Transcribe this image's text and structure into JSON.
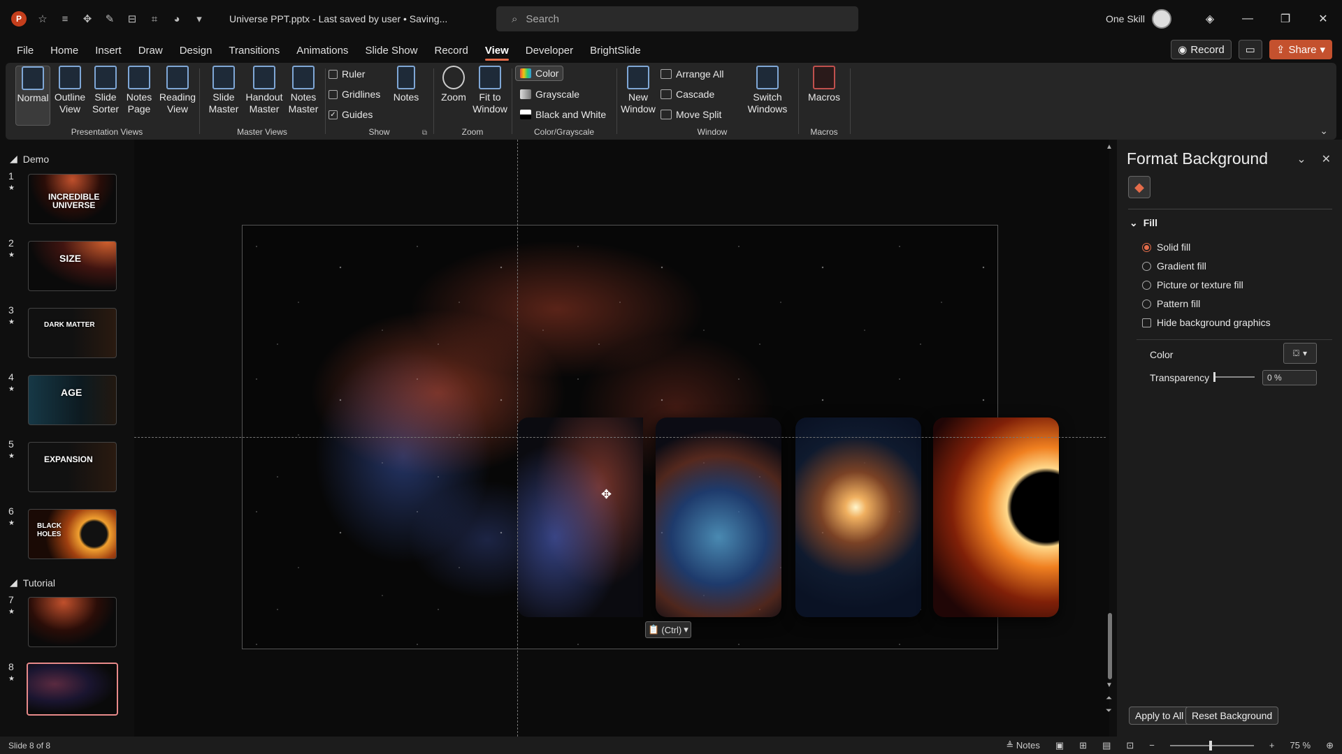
{
  "app": {
    "logo": "P",
    "doc_title": "Universe PPT.pptx  -  Last saved by user  •  Saving...",
    "user": "One Skill"
  },
  "search": {
    "placeholder": "Search"
  },
  "menu": {
    "tabs": [
      "File",
      "Home",
      "Insert",
      "Draw",
      "Design",
      "Transitions",
      "Animations",
      "Slide Show",
      "Record",
      "View",
      "Developer",
      "BrightSlide"
    ],
    "active": "View"
  },
  "menu_right": {
    "record": "Record",
    "share": "Share"
  },
  "ribbon": {
    "presentation_views": {
      "label": "Presentation Views",
      "buttons": [
        "Normal",
        "Outline\nView",
        "Slide\nSorter",
        "Notes\nPage",
        "Reading\nView"
      ]
    },
    "master_views": {
      "label": "Master Views",
      "buttons": [
        "Slide\nMaster",
        "Handout\nMaster",
        "Notes\nMaster"
      ]
    },
    "show": {
      "label": "Show",
      "ruler": "Ruler",
      "gridlines": "Gridlines",
      "guides": "Guides",
      "notes": "Notes"
    },
    "zoom": {
      "label": "Zoom",
      "zoom": "Zoom",
      "fit": "Fit to\nWindow"
    },
    "color": {
      "label": "Color/Grayscale",
      "color": "Color",
      "grayscale": "Grayscale",
      "bw": "Black and White"
    },
    "window": {
      "label": "Window",
      "new": "New\nWindow",
      "arrange": "Arrange All",
      "cascade": "Cascade",
      "move_split": "Move Split",
      "switch": "Switch\nWindows"
    },
    "macros": {
      "label": "Macros",
      "macros": "Macros"
    }
  },
  "slides": {
    "sections": [
      "Demo",
      "Tutorial"
    ],
    "items": [
      {
        "num": "1",
        "text": "INCREDIBLE\nUNIVERSE"
      },
      {
        "num": "2",
        "text": "SIZE"
      },
      {
        "num": "3",
        "text": "DARK MATTER"
      },
      {
        "num": "4",
        "text": "AGE"
      },
      {
        "num": "5",
        "text": "EXPANSION"
      },
      {
        "num": "6",
        "text": "BLACK\nHOLES"
      },
      {
        "num": "7",
        "text": ""
      },
      {
        "num": "8",
        "text": ""
      }
    ]
  },
  "paste_options": "(Ctrl)",
  "pane": {
    "title": "Format Background",
    "fill_header": "Fill",
    "options": [
      "Solid fill",
      "Gradient fill",
      "Picture or texture fill",
      "Pattern fill"
    ],
    "hide_bg": "Hide background graphics",
    "color_label": "Color",
    "transparency_label": "Transparency",
    "transparency_value": "0 %",
    "apply_all": "Apply to All",
    "reset": "Reset Background"
  },
  "status": {
    "slide_info": "Slide 8 of 8",
    "notes": "Notes",
    "zoom": "75 %",
    "zoom_value": 75
  }
}
